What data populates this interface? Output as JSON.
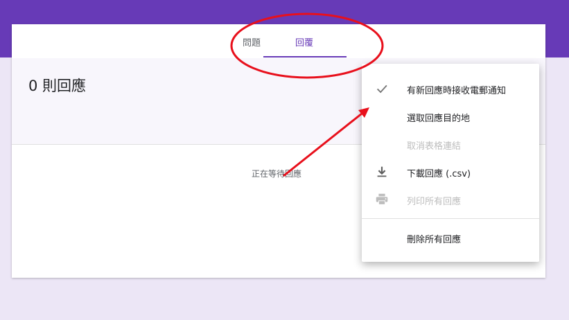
{
  "tabs": {
    "questions": "問題",
    "responses": "回覆"
  },
  "summary": {
    "title": "0 則回應"
  },
  "empty_state": {
    "message": "正在等待回應"
  },
  "menu": {
    "items": [
      {
        "label": "有新回應時接收電郵通知",
        "icon": "check-icon",
        "enabled": true
      },
      {
        "label": "選取回應目的地",
        "icon": "",
        "enabled": true
      },
      {
        "label": "取消表格連結",
        "icon": "",
        "enabled": false
      },
      {
        "label": "下載回應 (.csv)",
        "icon": "download-icon",
        "enabled": true
      },
      {
        "label": "列印所有回應",
        "icon": "print-icon",
        "enabled": false
      },
      {
        "label": "刪除所有回應",
        "icon": "",
        "enabled": true
      }
    ]
  },
  "colors": {
    "brand": "#673ab7",
    "annotation": "#e8101c"
  }
}
